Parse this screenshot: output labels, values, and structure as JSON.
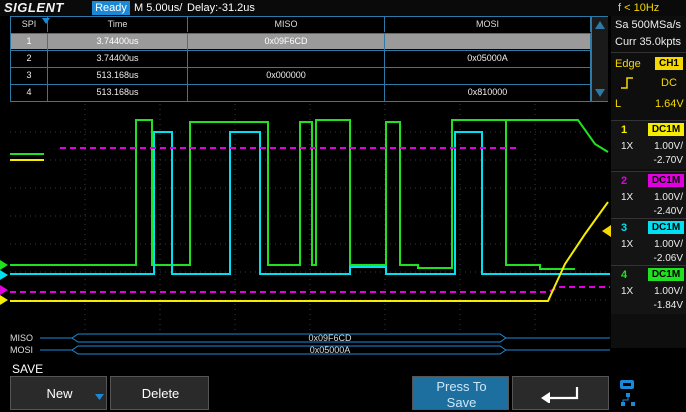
{
  "topbar": {
    "brand": "SIGLENT",
    "status": "Ready",
    "timebase": "M 5.00us/",
    "delay": "Delay:-31.2us",
    "frequency": "f < 10Hz"
  },
  "decode_table": {
    "headers": [
      "SPI",
      "Time",
      "MISO",
      "MOSI"
    ],
    "rows": [
      {
        "index": "1",
        "time": "3.74400us",
        "miso": "0x09F6CD",
        "mosi": ""
      },
      {
        "index": "2",
        "time": "3.74400us",
        "miso": "",
        "mosi": "0x05000A"
      },
      {
        "index": "3",
        "time": "513.168us",
        "miso": "0x000000",
        "mosi": ""
      },
      {
        "index": "4",
        "time": "513.168us",
        "miso": "",
        "mosi": "0x810000"
      }
    ],
    "selected_row": 0
  },
  "acquisition": {
    "sample_rate": "Sa 500MSa/s",
    "memory": "Curr 35.0kpts"
  },
  "trigger": {
    "type": "Edge",
    "source": "CH1",
    "coupling": "DC",
    "level_label": "L",
    "level": "1.64V"
  },
  "channels": [
    {
      "number": "1",
      "coupling": "DC1M",
      "probe": "1X",
      "scale": "1.00V/",
      "offset": "-2.70V",
      "color": "#f5ec00"
    },
    {
      "number": "2",
      "coupling": "DC1M",
      "probe": "1X",
      "scale": "1.00V/",
      "offset": "-2.40V",
      "color": "#e000e0"
    },
    {
      "number": "3",
      "coupling": "DC1M",
      "probe": "1X",
      "scale": "1.00V/",
      "offset": "-2.06V",
      "color": "#00e0f0"
    },
    {
      "number": "4",
      "coupling": "DC1M",
      "probe": "1X",
      "scale": "1.00V/",
      "offset": "-1.84V",
      "color": "#20e020"
    }
  ],
  "bus": {
    "miso_label": "MISO",
    "miso_value": "0x09F6CD",
    "mosi_label": "MOSI",
    "mosi_value": "0x05000A"
  },
  "softkeys": {
    "menu_title": "SAVE",
    "new_label": "New",
    "delete_label": "Delete",
    "press_to_save_line1": "Press To",
    "press_to_save_line2": "Save"
  }
}
